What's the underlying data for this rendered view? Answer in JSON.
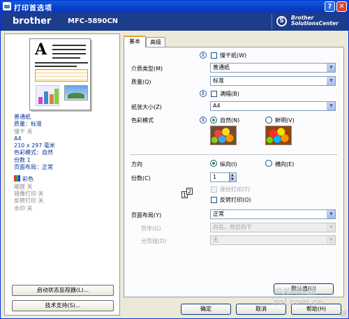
{
  "window": {
    "title": "打印首选项"
  },
  "brand": {
    "logo": "brother",
    "model": "MFC-5890CN",
    "solutions": [
      "Brother",
      "SolutionsCenter"
    ]
  },
  "summary": {
    "media": "普通纸",
    "quality": "质量：标准",
    "slow_dry": "慢干 关",
    "paper": "A4",
    "paper_dims": "210 x 297 毫米",
    "color_mode": "色彩模式：自然",
    "copies": "份数 1",
    "layout": "页面布局：正常",
    "color": "彩色",
    "scale": "缩放 关",
    "mirror": "镜像打印 关",
    "reverse": "反转打印 关",
    "watermark": "水印 关"
  },
  "left_buttons": {
    "status_monitor": "启动状态监视器(L)...",
    "support": "技术支持(S)..."
  },
  "tabs": [
    "基本",
    "高级"
  ],
  "basic": {
    "slow_dry_paper": "慢干纸(W)",
    "media_type": {
      "label": "介质类型(M)",
      "value": "普通纸"
    },
    "quality": {
      "label": "质量(Q)",
      "value": "标准"
    },
    "borderless": "满幅(B)",
    "paper_size": {
      "label": "纸张大小(Z)",
      "value": "A4"
    },
    "color_mode": {
      "label": "色彩模式",
      "natural": "自然(N)",
      "vivid": "鲜明(V)"
    },
    "orientation": {
      "label": "方向",
      "portrait": "纵向(I)",
      "landscape": "横向(E)"
    },
    "copies": {
      "label": "份数(C)",
      "value": "1"
    },
    "collate": "逐份打印(T)",
    "reverse_order": "反转打印(O)",
    "layout": {
      "label": "页面布局(Y)",
      "value": "正常"
    },
    "page_order": {
      "label": "页序(G)",
      "value": "向右，然后向下"
    },
    "border_line": {
      "label": "分页线(D)",
      "value": "无"
    },
    "default_button": "默认值(U)"
  },
  "footer": {
    "ok": "确定",
    "cancel": "取消",
    "help": "帮助(H)"
  },
  "watermark_text": "中关村在线 zol.com.cn"
}
